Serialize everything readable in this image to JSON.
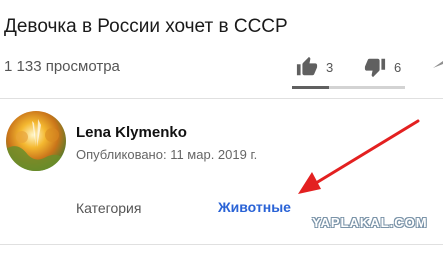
{
  "video": {
    "title": "Девочка в России хочет в СССР",
    "views": "1 133 просмотра",
    "likes": "3",
    "dislikes": "6",
    "like_share": 0.33
  },
  "channel": {
    "name": "Lena Klymenko",
    "published": "Опубликовано: 11 мар. 2019 г."
  },
  "metadata": {
    "category_label": "Категория",
    "category_value": "Животные"
  },
  "annotation": {
    "arrow_color": "#e32020"
  },
  "watermark": {
    "text": "YAPLAKAL.COM"
  },
  "icons": {
    "like": "thumbs-up-icon",
    "dislike": "thumbs-down-icon",
    "share": "share-icon"
  }
}
